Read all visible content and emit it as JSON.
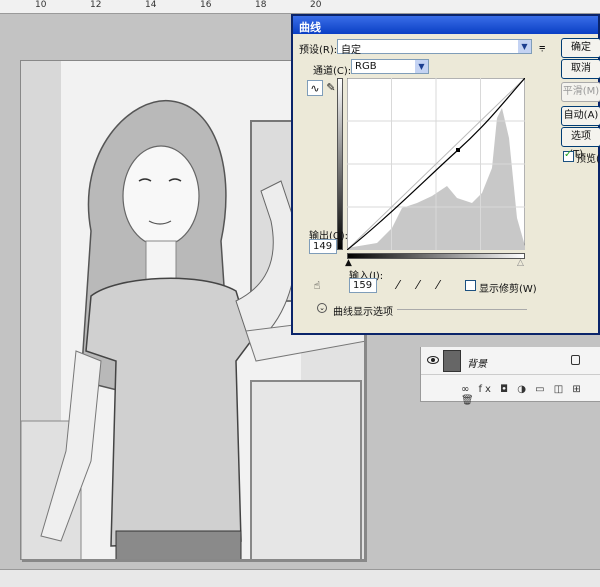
{
  "ruler": {
    "labels": [
      "10",
      "12",
      "14",
      "16",
      "18",
      "20"
    ]
  },
  "dialog": {
    "title": "曲线",
    "preset_label": "预设(R):",
    "preset_value": "自定",
    "channel_label": "通道(C):",
    "channel_value": "RGB",
    "output_label": "输出(O):",
    "output_value": "149",
    "input_label": "输入(I):",
    "input_value": "159",
    "show_clipping_label": "显示修剪(W)",
    "curve_options_label": "曲线显示选项",
    "buttons": {
      "ok": "确定",
      "cancel": "取消",
      "smooth": "平滑(M)",
      "auto": "自动(A)",
      "options": "选项(T)...",
      "preview": "预览(P)"
    },
    "preview_checked": true,
    "show_clipping_checked": false
  },
  "layers": {
    "layer_name": "背景",
    "tools": "∞ fx ◘ ◑ ▭ ◫ ⊞ 🗑"
  },
  "colors": {
    "title_bar": "#0a3fc4",
    "dialog_bg": "#ece9d8",
    "histogram": "#c8c8c8"
  }
}
